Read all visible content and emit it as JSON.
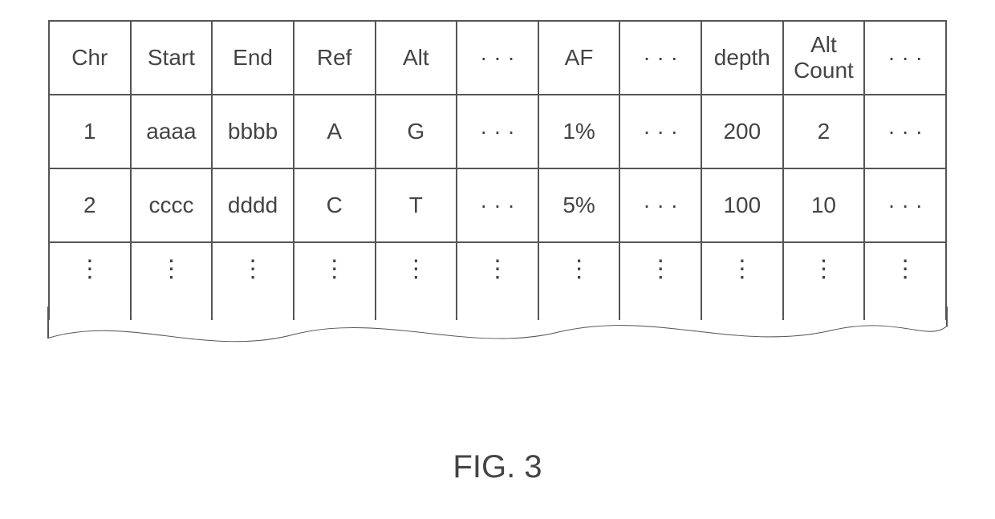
{
  "figure_label": "FIG. 3",
  "ellipsis_h": "· · ·",
  "ellipsis_v": "⋮",
  "table": {
    "headers": [
      "Chr",
      "Start",
      "End",
      "Ref",
      "Alt",
      "· · ·",
      "AF",
      "· · ·",
      "depth",
      "Alt\nCount",
      "· · ·"
    ],
    "rows": [
      [
        "1",
        "aaaa",
        "bbbb",
        "A",
        "G",
        "· · ·",
        "1%",
        "· · ·",
        "200",
        "2",
        "· · ·"
      ],
      [
        "2",
        "cccc",
        "dddd",
        "C",
        "T",
        "· · ·",
        "5%",
        "· · ·",
        "100",
        "10",
        "· · ·"
      ]
    ]
  }
}
